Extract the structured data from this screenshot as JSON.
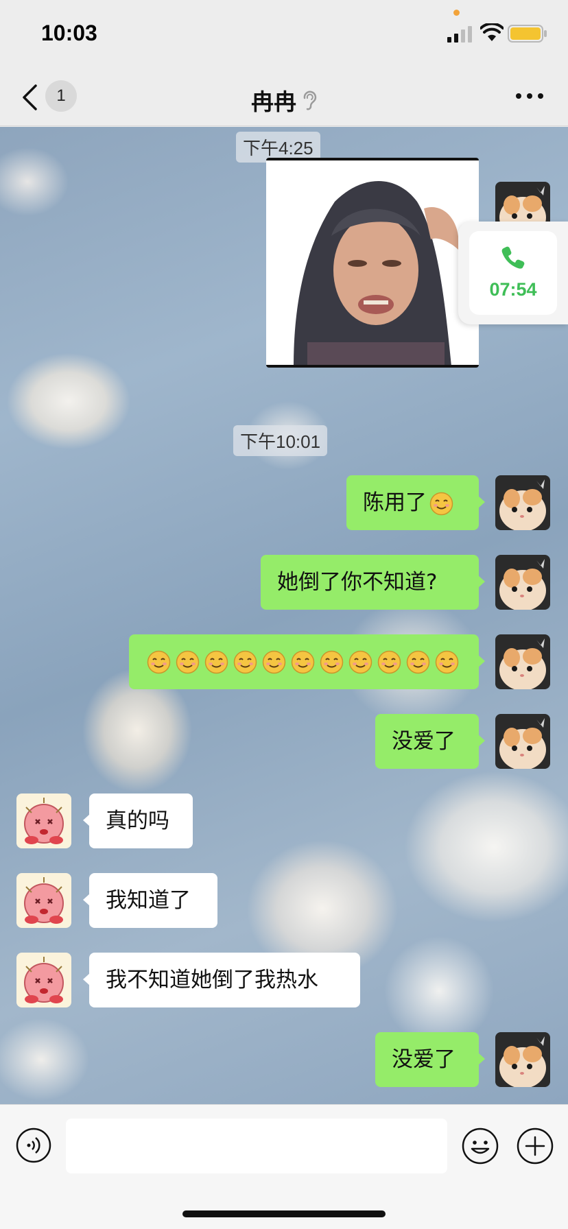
{
  "status_bar": {
    "time": "10:03"
  },
  "header": {
    "unread_count": "1",
    "title": "冉冉"
  },
  "messages": {
    "time_1": "下午4:25",
    "time_2": "下午10:01",
    "m1": "陈用了",
    "m2": "她倒了你不知道?",
    "m4": "没爱了",
    "m5": "真的吗",
    "m6": "我知道了",
    "m7": "我不知道她倒了我热水",
    "m8": "没爱了"
  },
  "call_widget": {
    "duration": "07:54"
  },
  "input": {
    "value": "",
    "placeholder": ""
  },
  "colors": {
    "my_bubble": "#95ec69",
    "their_bubble": "#ffffff",
    "call_green": "#3fbe57",
    "nav_bg": "#ededed"
  },
  "icons": [
    "back-chevron-icon",
    "ear-icon",
    "more-icon",
    "phone-icon",
    "voice-icon",
    "emoji-icon",
    "plus-icon",
    "smiley-emoji-icon"
  ]
}
